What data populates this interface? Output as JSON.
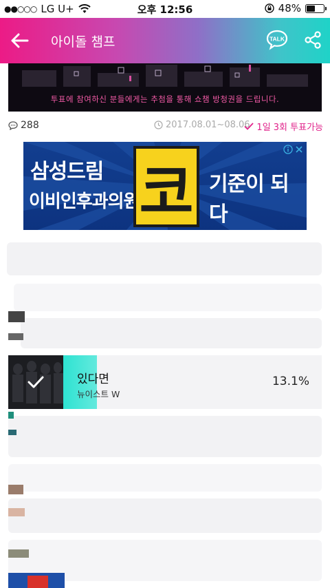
{
  "status_bar": {
    "carrier": "LG U+",
    "time": "오후 12:56",
    "battery": "48%",
    "battery_level": 0.48
  },
  "header": {
    "title": "아이돌 챔프",
    "talk_label": "TALK",
    "back_icon": "back-arrow-icon",
    "share_icon": "share-icon"
  },
  "banner": {
    "text": "투표에 참여하신 분들에게는 추첨을 통해 쇼챔 방청권을 드립니다."
  },
  "meta": {
    "comment_count": "288",
    "date_range": "2017.08.01~08.06",
    "vote_limit": "1일 3회 투표가능"
  },
  "ad": {
    "line1": "삼성드림",
    "line2": "이비인후과의원",
    "big_char": "코",
    "line3": "기준이 되다"
  },
  "vote_item": {
    "title": "있다면",
    "artist": "뉴이스트 W",
    "percent": "13.1%",
    "percent_value": 0.131,
    "selected": true
  },
  "colors": {
    "accent_pink": "#e0228a",
    "accent_teal": "#2ee3d2"
  }
}
